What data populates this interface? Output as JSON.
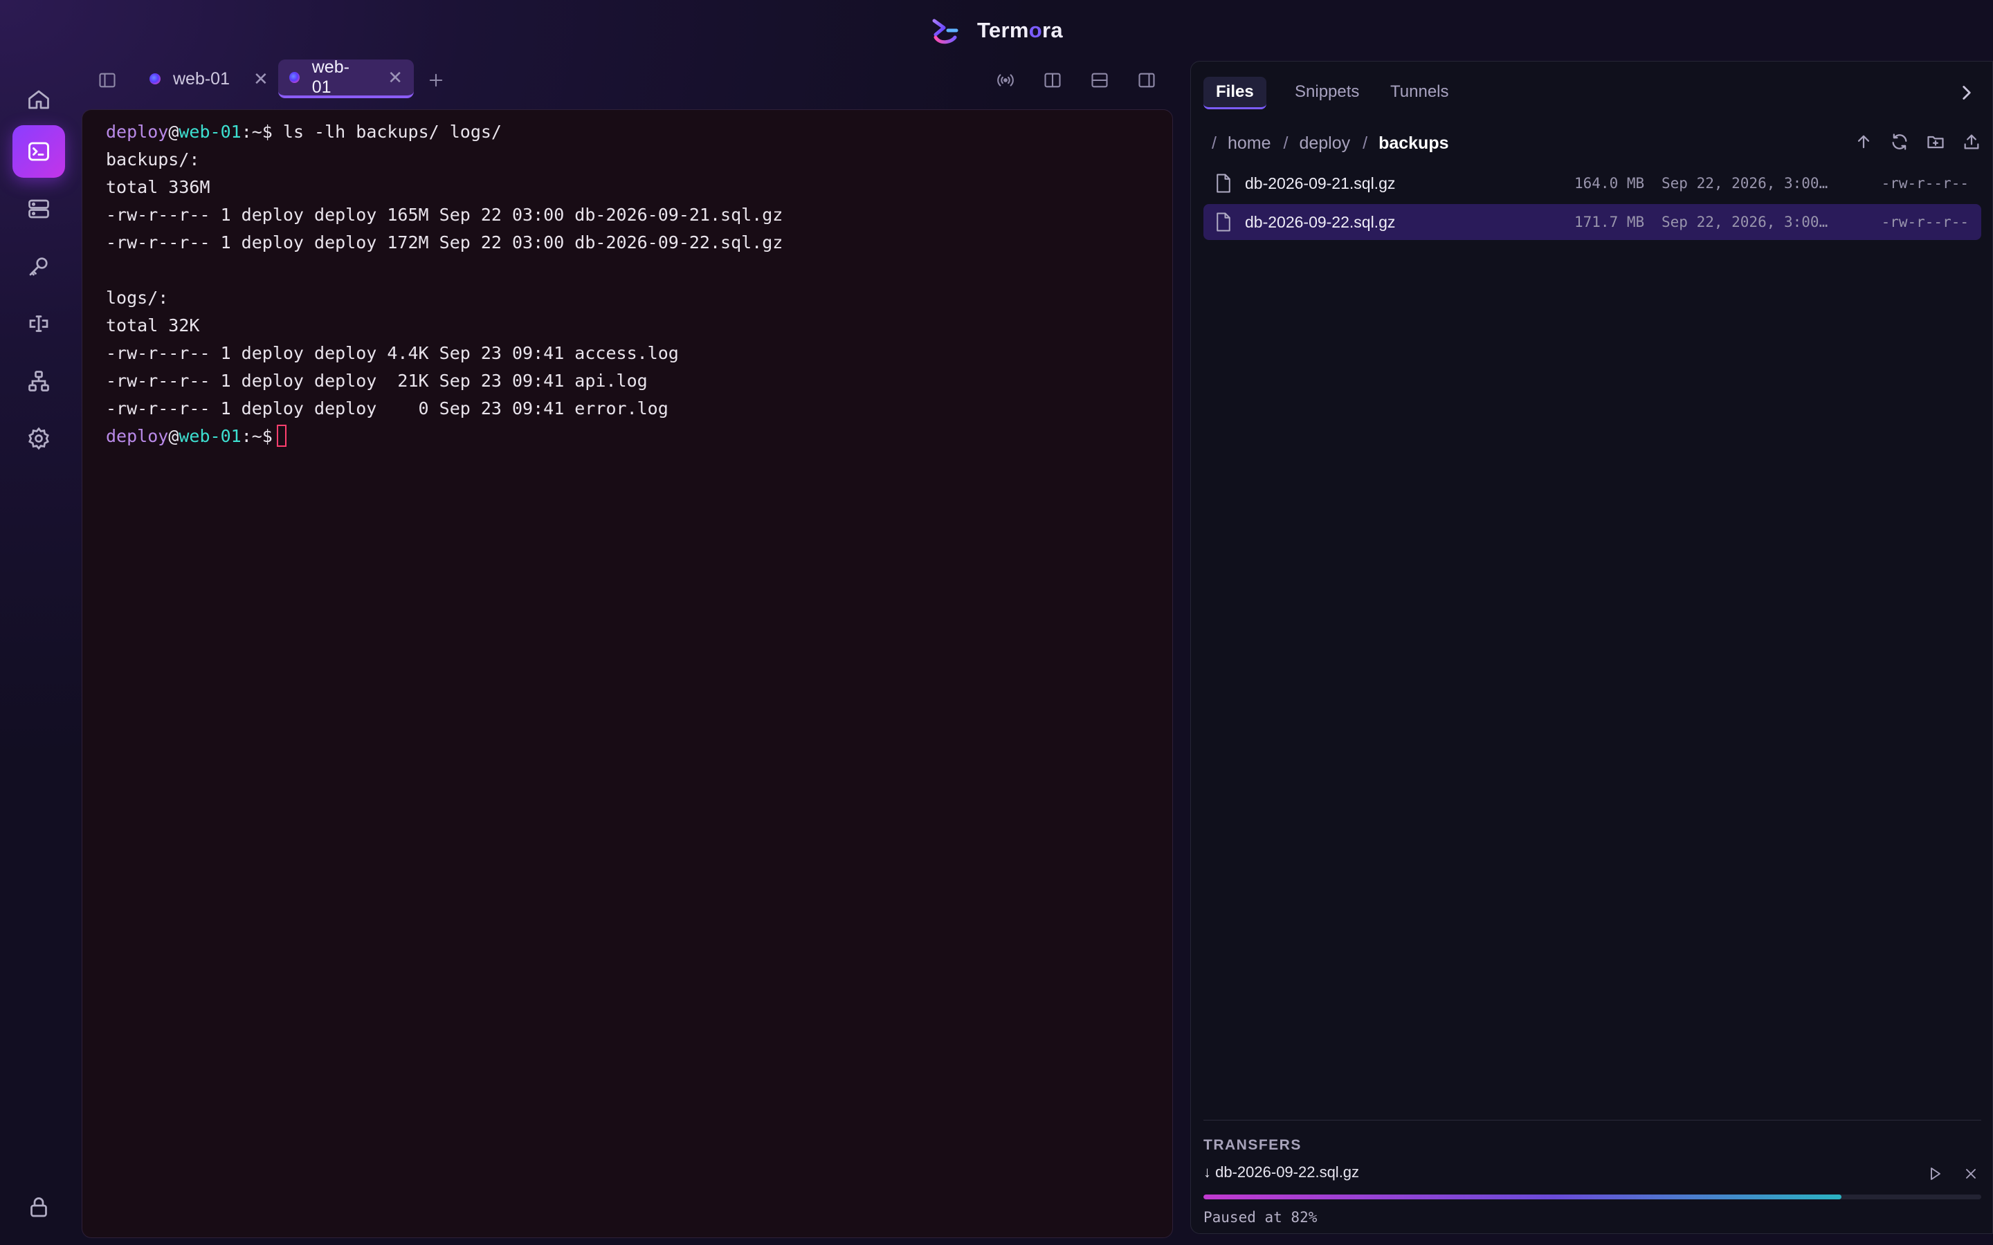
{
  "app": {
    "name_main": "Term",
    "name_accent": "o",
    "name_tail": "ra"
  },
  "tabs": [
    {
      "label": "web-01",
      "active": false
    },
    {
      "label": "web-01",
      "active": true
    }
  ],
  "terminal": {
    "prompt": {
      "user": "deploy",
      "at": "@",
      "host": "web-01",
      "path": ":~$"
    },
    "command": "ls -lh backups/ logs/",
    "output": [
      "backups/:",
      "total 336M",
      "-rw-r--r-- 1 deploy deploy 165M Sep 22 03:00 db-2026-09-21.sql.gz",
      "-rw-r--r-- 1 deploy deploy 172M Sep 22 03:00 db-2026-09-22.sql.gz",
      "",
      "logs/:",
      "total 32K",
      "-rw-r--r-- 1 deploy deploy 4.4K Sep 23 09:41 access.log",
      "-rw-r--r-- 1 deploy deploy  21K Sep 23 09:41 api.log",
      "-rw-r--r-- 1 deploy deploy    0 Sep 23 09:41 error.log"
    ]
  },
  "sidepanel": {
    "tabs": [
      "Files",
      "Snippets",
      "Tunnels"
    ],
    "active_tab": "Files",
    "breadcrumb": [
      {
        "sep": "/",
        "label": ""
      },
      {
        "sep": "",
        "label": "home"
      },
      {
        "sep": "/",
        "label": "deploy"
      },
      {
        "sep": "/",
        "label": "backups"
      }
    ],
    "files": [
      {
        "name": "db-2026-09-21.sql.gz",
        "size": "164.0 MB",
        "date": "Sep 22, 2026, 3:00…",
        "perm": "-rw-r--r--",
        "selected": false
      },
      {
        "name": "db-2026-09-22.sql.gz",
        "size": "171.7 MB",
        "date": "Sep 22, 2026, 3:00…",
        "perm": "-rw-r--r--",
        "selected": true
      }
    ],
    "transfers": {
      "title": "TRANSFERS",
      "item": {
        "arrow": "↓",
        "name": "db-2026-09-22.sql.gz",
        "progress": 0.82,
        "status": "Paused at 82%"
      }
    }
  },
  "colors": {
    "accent": "#7b5cff",
    "active_rail": "#8b3dff",
    "prompt_user": "#b98ae8",
    "prompt_host": "#3ddfd0",
    "cursor": "#ff3f6e"
  },
  "icons": {
    "rail": [
      "home-icon",
      "terminal-icon",
      "servers-icon",
      "key-icon",
      "forward-icon",
      "network-icon",
      "settings-icon",
      "lock-icon"
    ],
    "toolbar": [
      "sidebar-toggle-icon",
      "broadcast-icon",
      "split-vertical-icon",
      "split-horizontal-icon",
      "right-panel-icon"
    ]
  }
}
